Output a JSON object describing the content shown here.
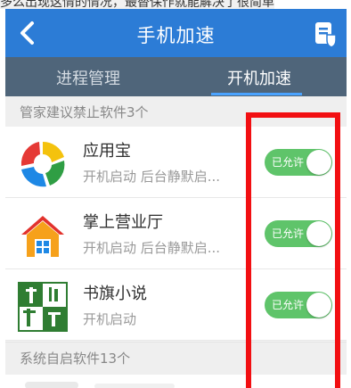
{
  "caption": {
    "text": "多么出现这情的情况，最替保作就能解决了很简单"
  },
  "titlebar": {
    "title": "手机加速",
    "back_icon": "chevron-left-icon",
    "menu_icon": "clipboard-shield-icon"
  },
  "tabs": [
    {
      "label": "进程管理",
      "active": false
    },
    {
      "label": "开机加速",
      "active": true
    }
  ],
  "sections": {
    "suggested": "管家建议禁止软件3个",
    "system": "系统自启软件13个"
  },
  "apps": [
    {
      "name": "应用宝",
      "desc": "开机启动 后台静默启...",
      "toggle": "已允许",
      "icon": "yingyongbao-icon"
    },
    {
      "name": "掌上营业厅",
      "desc": "开机启动 后台静默启...",
      "toggle": "已允许",
      "icon": "house-icon"
    },
    {
      "name": "书旗小说",
      "desc": "开机启动",
      "toggle": "已允许",
      "icon": "shuqi-icon"
    }
  ],
  "colors": {
    "titlebar": "#2c7cd6",
    "tabs": "#4f657a",
    "toggle_on": "#5fc46a",
    "highlight": "#f20f12"
  }
}
